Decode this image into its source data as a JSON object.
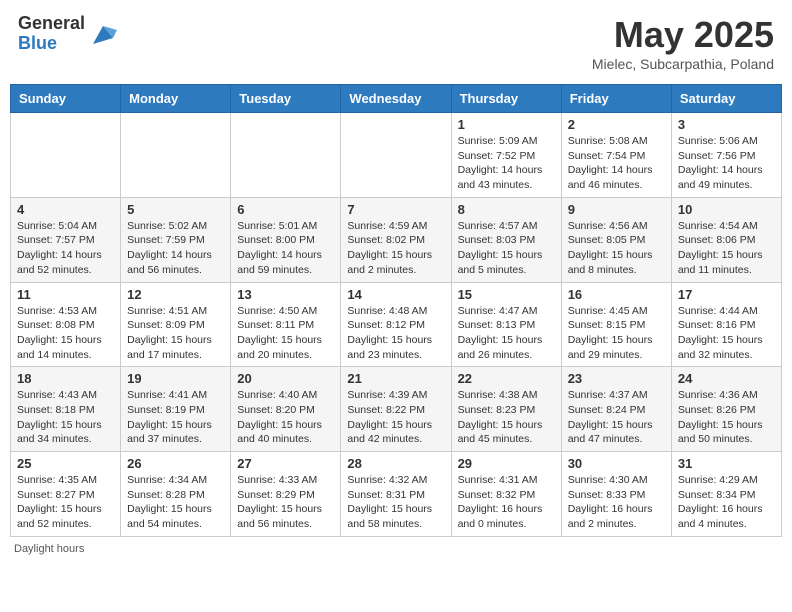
{
  "header": {
    "logo_general": "General",
    "logo_blue": "Blue",
    "month_title": "May 2025",
    "location": "Mielec, Subcarpathia, Poland"
  },
  "days_of_week": [
    "Sunday",
    "Monday",
    "Tuesday",
    "Wednesday",
    "Thursday",
    "Friday",
    "Saturday"
  ],
  "weeks": [
    [
      {
        "day": "",
        "sunrise": "",
        "sunset": "",
        "daylight": ""
      },
      {
        "day": "",
        "sunrise": "",
        "sunset": "",
        "daylight": ""
      },
      {
        "day": "",
        "sunrise": "",
        "sunset": "",
        "daylight": ""
      },
      {
        "day": "",
        "sunrise": "",
        "sunset": "",
        "daylight": ""
      },
      {
        "day": "1",
        "sunrise": "Sunrise: 5:09 AM",
        "sunset": "Sunset: 7:52 PM",
        "daylight": "Daylight: 14 hours and 43 minutes."
      },
      {
        "day": "2",
        "sunrise": "Sunrise: 5:08 AM",
        "sunset": "Sunset: 7:54 PM",
        "daylight": "Daylight: 14 hours and 46 minutes."
      },
      {
        "day": "3",
        "sunrise": "Sunrise: 5:06 AM",
        "sunset": "Sunset: 7:56 PM",
        "daylight": "Daylight: 14 hours and 49 minutes."
      }
    ],
    [
      {
        "day": "4",
        "sunrise": "Sunrise: 5:04 AM",
        "sunset": "Sunset: 7:57 PM",
        "daylight": "Daylight: 14 hours and 52 minutes."
      },
      {
        "day": "5",
        "sunrise": "Sunrise: 5:02 AM",
        "sunset": "Sunset: 7:59 PM",
        "daylight": "Daylight: 14 hours and 56 minutes."
      },
      {
        "day": "6",
        "sunrise": "Sunrise: 5:01 AM",
        "sunset": "Sunset: 8:00 PM",
        "daylight": "Daylight: 14 hours and 59 minutes."
      },
      {
        "day": "7",
        "sunrise": "Sunrise: 4:59 AM",
        "sunset": "Sunset: 8:02 PM",
        "daylight": "Daylight: 15 hours and 2 minutes."
      },
      {
        "day": "8",
        "sunrise": "Sunrise: 4:57 AM",
        "sunset": "Sunset: 8:03 PM",
        "daylight": "Daylight: 15 hours and 5 minutes."
      },
      {
        "day": "9",
        "sunrise": "Sunrise: 4:56 AM",
        "sunset": "Sunset: 8:05 PM",
        "daylight": "Daylight: 15 hours and 8 minutes."
      },
      {
        "day": "10",
        "sunrise": "Sunrise: 4:54 AM",
        "sunset": "Sunset: 8:06 PM",
        "daylight": "Daylight: 15 hours and 11 minutes."
      }
    ],
    [
      {
        "day": "11",
        "sunrise": "Sunrise: 4:53 AM",
        "sunset": "Sunset: 8:08 PM",
        "daylight": "Daylight: 15 hours and 14 minutes."
      },
      {
        "day": "12",
        "sunrise": "Sunrise: 4:51 AM",
        "sunset": "Sunset: 8:09 PM",
        "daylight": "Daylight: 15 hours and 17 minutes."
      },
      {
        "day": "13",
        "sunrise": "Sunrise: 4:50 AM",
        "sunset": "Sunset: 8:11 PM",
        "daylight": "Daylight: 15 hours and 20 minutes."
      },
      {
        "day": "14",
        "sunrise": "Sunrise: 4:48 AM",
        "sunset": "Sunset: 8:12 PM",
        "daylight": "Daylight: 15 hours and 23 minutes."
      },
      {
        "day": "15",
        "sunrise": "Sunrise: 4:47 AM",
        "sunset": "Sunset: 8:13 PM",
        "daylight": "Daylight: 15 hours and 26 minutes."
      },
      {
        "day": "16",
        "sunrise": "Sunrise: 4:45 AM",
        "sunset": "Sunset: 8:15 PM",
        "daylight": "Daylight: 15 hours and 29 minutes."
      },
      {
        "day": "17",
        "sunrise": "Sunrise: 4:44 AM",
        "sunset": "Sunset: 8:16 PM",
        "daylight": "Daylight: 15 hours and 32 minutes."
      }
    ],
    [
      {
        "day": "18",
        "sunrise": "Sunrise: 4:43 AM",
        "sunset": "Sunset: 8:18 PM",
        "daylight": "Daylight: 15 hours and 34 minutes."
      },
      {
        "day": "19",
        "sunrise": "Sunrise: 4:41 AM",
        "sunset": "Sunset: 8:19 PM",
        "daylight": "Daylight: 15 hours and 37 minutes."
      },
      {
        "day": "20",
        "sunrise": "Sunrise: 4:40 AM",
        "sunset": "Sunset: 8:20 PM",
        "daylight": "Daylight: 15 hours and 40 minutes."
      },
      {
        "day": "21",
        "sunrise": "Sunrise: 4:39 AM",
        "sunset": "Sunset: 8:22 PM",
        "daylight": "Daylight: 15 hours and 42 minutes."
      },
      {
        "day": "22",
        "sunrise": "Sunrise: 4:38 AM",
        "sunset": "Sunset: 8:23 PM",
        "daylight": "Daylight: 15 hours and 45 minutes."
      },
      {
        "day": "23",
        "sunrise": "Sunrise: 4:37 AM",
        "sunset": "Sunset: 8:24 PM",
        "daylight": "Daylight: 15 hours and 47 minutes."
      },
      {
        "day": "24",
        "sunrise": "Sunrise: 4:36 AM",
        "sunset": "Sunset: 8:26 PM",
        "daylight": "Daylight: 15 hours and 50 minutes."
      }
    ],
    [
      {
        "day": "25",
        "sunrise": "Sunrise: 4:35 AM",
        "sunset": "Sunset: 8:27 PM",
        "daylight": "Daylight: 15 hours and 52 minutes."
      },
      {
        "day": "26",
        "sunrise": "Sunrise: 4:34 AM",
        "sunset": "Sunset: 8:28 PM",
        "daylight": "Daylight: 15 hours and 54 minutes."
      },
      {
        "day": "27",
        "sunrise": "Sunrise: 4:33 AM",
        "sunset": "Sunset: 8:29 PM",
        "daylight": "Daylight: 15 hours and 56 minutes."
      },
      {
        "day": "28",
        "sunrise": "Sunrise: 4:32 AM",
        "sunset": "Sunset: 8:31 PM",
        "daylight": "Daylight: 15 hours and 58 minutes."
      },
      {
        "day": "29",
        "sunrise": "Sunrise: 4:31 AM",
        "sunset": "Sunset: 8:32 PM",
        "daylight": "Daylight: 16 hours and 0 minutes."
      },
      {
        "day": "30",
        "sunrise": "Sunrise: 4:30 AM",
        "sunset": "Sunset: 8:33 PM",
        "daylight": "Daylight: 16 hours and 2 minutes."
      },
      {
        "day": "31",
        "sunrise": "Sunrise: 4:29 AM",
        "sunset": "Sunset: 8:34 PM",
        "daylight": "Daylight: 16 hours and 4 minutes."
      }
    ]
  ],
  "footer": {
    "daylight_hours": "Daylight hours"
  }
}
